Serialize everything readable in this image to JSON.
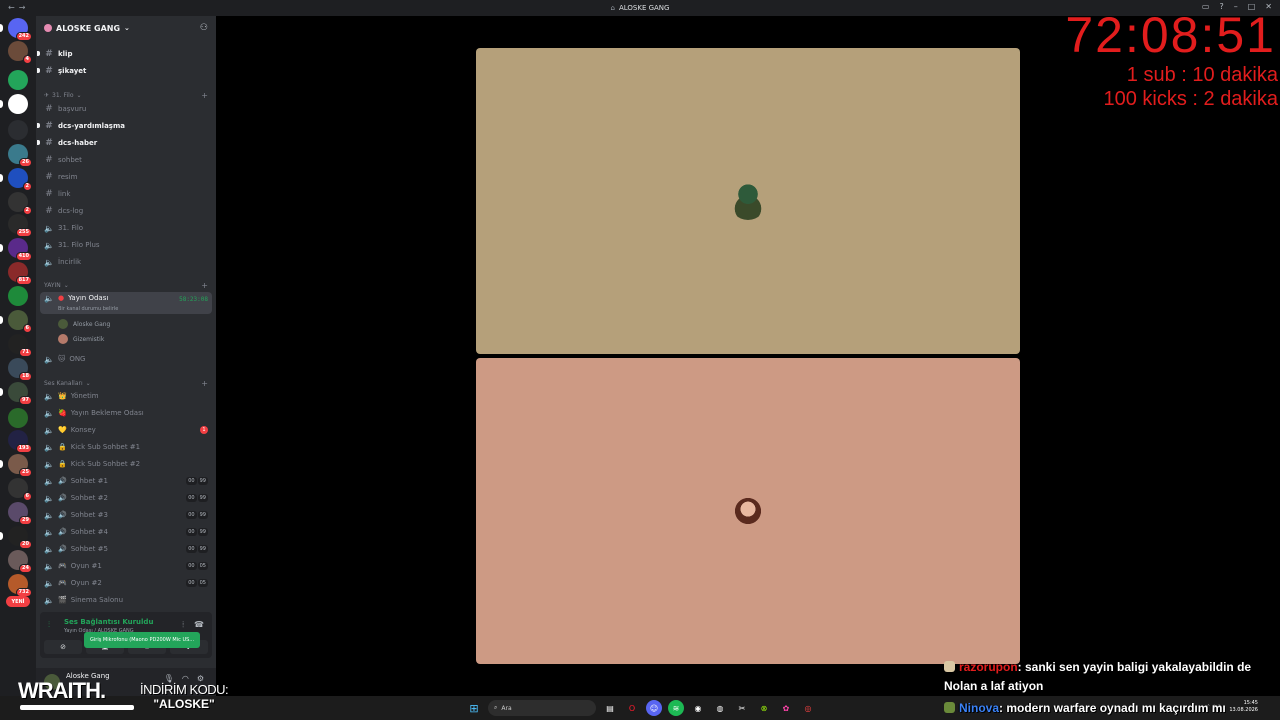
{
  "window": {
    "title": "ALOSKE GANG"
  },
  "server": {
    "name": "ALOSKE GANG"
  },
  "rail": {
    "badges": [
      {
        "label": "242",
        "color": "#5865f2"
      },
      {
        "label": "4",
        "color": "#6b4b3a"
      },
      {
        "label": "",
        "color": "#23a55a"
      },
      {
        "label": "",
        "color": "#ffffff"
      },
      {
        "label": "",
        "color": "#2b2d31"
      },
      {
        "label": "26",
        "color": "#3a7a8c"
      },
      {
        "label": "2",
        "color": "#1f4fbf"
      },
      {
        "label": "2",
        "color": "#333333"
      },
      {
        "label": "255",
        "color": "#2a2a2a"
      },
      {
        "label": "410",
        "color": "#5a2a8a"
      },
      {
        "label": "817",
        "color": "#8a2a2a"
      },
      {
        "label": "",
        "color": "#1e8a3a"
      },
      {
        "label": "6",
        "color": "#4a5a3a"
      },
      {
        "label": "71",
        "color": "#222222"
      },
      {
        "label": "18",
        "color": "#3a4a5a"
      },
      {
        "label": "97",
        "color": "#3a4a3a"
      },
      {
        "label": "",
        "color": "#2a6a2a"
      },
      {
        "label": "193",
        "color": "#222244"
      },
      {
        "label": "25",
        "color": "#7a5a4a"
      },
      {
        "label": "6",
        "color": "#333333"
      },
      {
        "label": "29",
        "color": "#5a4a6a"
      },
      {
        "label": "20",
        "color": "#222222"
      },
      {
        "label": "24",
        "color": "#6a5a5a"
      },
      {
        "label": "732",
        "color": "#b55a2a"
      }
    ],
    "new_label": "YENİ"
  },
  "channels": {
    "top": [
      "klip",
      "şikayet"
    ],
    "filo_category": "31. Filo",
    "filo": [
      {
        "name": "başvuru",
        "type": "text",
        "unread": false
      },
      {
        "name": "dcs-yardımlaşma",
        "type": "text",
        "unread": true
      },
      {
        "name": "dcs-haber",
        "type": "text",
        "unread": true
      },
      {
        "name": "sohbet",
        "type": "text",
        "unread": false
      },
      {
        "name": "resim",
        "type": "text",
        "unread": false
      },
      {
        "name": "link",
        "type": "text",
        "unread": false
      },
      {
        "name": "dcs-log",
        "type": "text",
        "unread": false
      },
      {
        "name": "31. Filo",
        "type": "voice",
        "unread": false
      },
      {
        "name": "31. Filo Plus",
        "type": "voice",
        "unread": false
      },
      {
        "name": "İncirlik",
        "type": "voice",
        "unread": false
      }
    ],
    "yayin_category": "YAYIN",
    "active": {
      "name": "Yayın Odası",
      "timer": "58:23:08",
      "subtitle": "Bir kanal durumu belirle"
    },
    "members": [
      "Aloske Gang",
      "Gizemistik"
    ],
    "ong": "ONG",
    "ses_category": "Ses Kanalları",
    "ses": [
      {
        "name": "Yönetim",
        "emoji": "👑",
        "counts": null,
        "mention": null
      },
      {
        "name": "Yayın Bekleme Odası",
        "emoji": "🍓",
        "counts": null,
        "mention": null
      },
      {
        "name": "Konsey",
        "emoji": "💛",
        "counts": null,
        "mention": "1"
      },
      {
        "name": "Kick Sub Sohbet #1",
        "emoji": "🔒",
        "counts": null,
        "mention": null
      },
      {
        "name": "Kick Sub Sohbet #2",
        "emoji": "🔒",
        "counts": null,
        "mention": null
      },
      {
        "name": "Sohbet #1",
        "emoji": "🔊",
        "counts": [
          "00",
          "99"
        ],
        "mention": null
      },
      {
        "name": "Sohbet #2",
        "emoji": "🔊",
        "counts": [
          "00",
          "99"
        ],
        "mention": null
      },
      {
        "name": "Sohbet #3",
        "emoji": "🔊",
        "counts": [
          "00",
          "99"
        ],
        "mention": null
      },
      {
        "name": "Sohbet #4",
        "emoji": "🔊",
        "counts": [
          "00",
          "99"
        ],
        "mention": null
      },
      {
        "name": "Sohbet #5",
        "emoji": "🔊",
        "counts": [
          "00",
          "99"
        ],
        "mention": null
      },
      {
        "name": "Oyun #1",
        "emoji": "🎮",
        "counts": [
          "00",
          "05"
        ],
        "mention": null
      },
      {
        "name": "Oyun #2",
        "emoji": "🎮",
        "counts": [
          "00",
          "05"
        ],
        "mention": null
      },
      {
        "name": "Sinema Salonu",
        "emoji": "🎬",
        "counts": null,
        "mention": null
      }
    ]
  },
  "voice_panel": {
    "status": "Ses Bağlantısı Kuruldu",
    "location": "Yayın Odası / ALOSKE GANG",
    "tooltip": "Giriş Mikrofonu (Maono PD200W Mic US..."
  },
  "user": {
    "name": "Aloske Gang"
  },
  "overlay": {
    "timer": "72:08:51",
    "rate1": "1 sub : 10 dakika",
    "rate2": "100 kicks : 2 dakika",
    "brand": "WRAITH.",
    "promo_line1": "İNDİRİM KODU:",
    "promo_line2": "\"ALOSKE\""
  },
  "tiles": [
    {
      "color": "#b5a07a"
    },
    {
      "color": "#cd9a84"
    }
  ],
  "chat": [
    {
      "user": "razorupon",
      "user_color": "#e21d1d",
      "text": ": sanki sen yayin baligi yakalayabildin de Nolan a laf atiyon"
    },
    {
      "user": "Ninova",
      "user_color": "#3b82f6",
      "text": ": modern warfare oynadı mı kaçırdım mı"
    }
  ],
  "taskbar": {
    "search_placeholder": "Ara",
    "time": "15:45",
    "date": "13.08.2026"
  }
}
